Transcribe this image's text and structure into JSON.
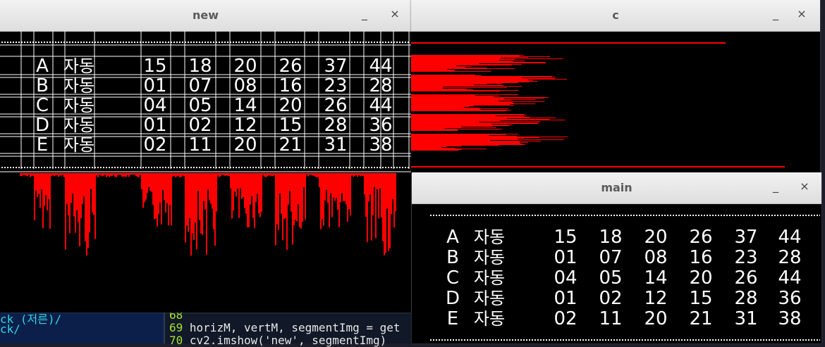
{
  "windows": {
    "new": {
      "title": "new",
      "minimize": "_",
      "close": "×"
    },
    "c": {
      "title": "c",
      "minimize": "_",
      "close": "×"
    },
    "main": {
      "title": "main",
      "minimize": "_",
      "close": "×"
    }
  },
  "lotto_rows": [
    {
      "letter": "A",
      "mode": "자동",
      "numbers": [
        "15",
        "18",
        "20",
        "26",
        "37",
        "44"
      ]
    },
    {
      "letter": "B",
      "mode": "자동",
      "numbers": [
        "01",
        "07",
        "08",
        "16",
        "23",
        "28"
      ]
    },
    {
      "letter": "C",
      "mode": "자동",
      "numbers": [
        "04",
        "05",
        "14",
        "20",
        "26",
        "44"
      ]
    },
    {
      "letter": "D",
      "mode": "자동",
      "numbers": [
        "01",
        "02",
        "12",
        "15",
        "28",
        "36"
      ]
    },
    {
      "letter": "E",
      "mode": "자동",
      "numbers": [
        "02",
        "11",
        "20",
        "21",
        "31",
        "38"
      ]
    }
  ],
  "terminal": {
    "left_lines": [
      "ck (저른)/",
      "ck/"
    ],
    "code_lines": [
      {
        "num": "68",
        "code": ""
      },
      {
        "num": "69",
        "code": "horizM, vertM, segmentImg = get"
      },
      {
        "num": "70",
        "code": "cv2.imshow('new', segmentImg)"
      }
    ]
  },
  "colors": {
    "histogram": "#ff0000",
    "text": "#ffffff",
    "grid": "#ffffff",
    "background": "#000000"
  }
}
